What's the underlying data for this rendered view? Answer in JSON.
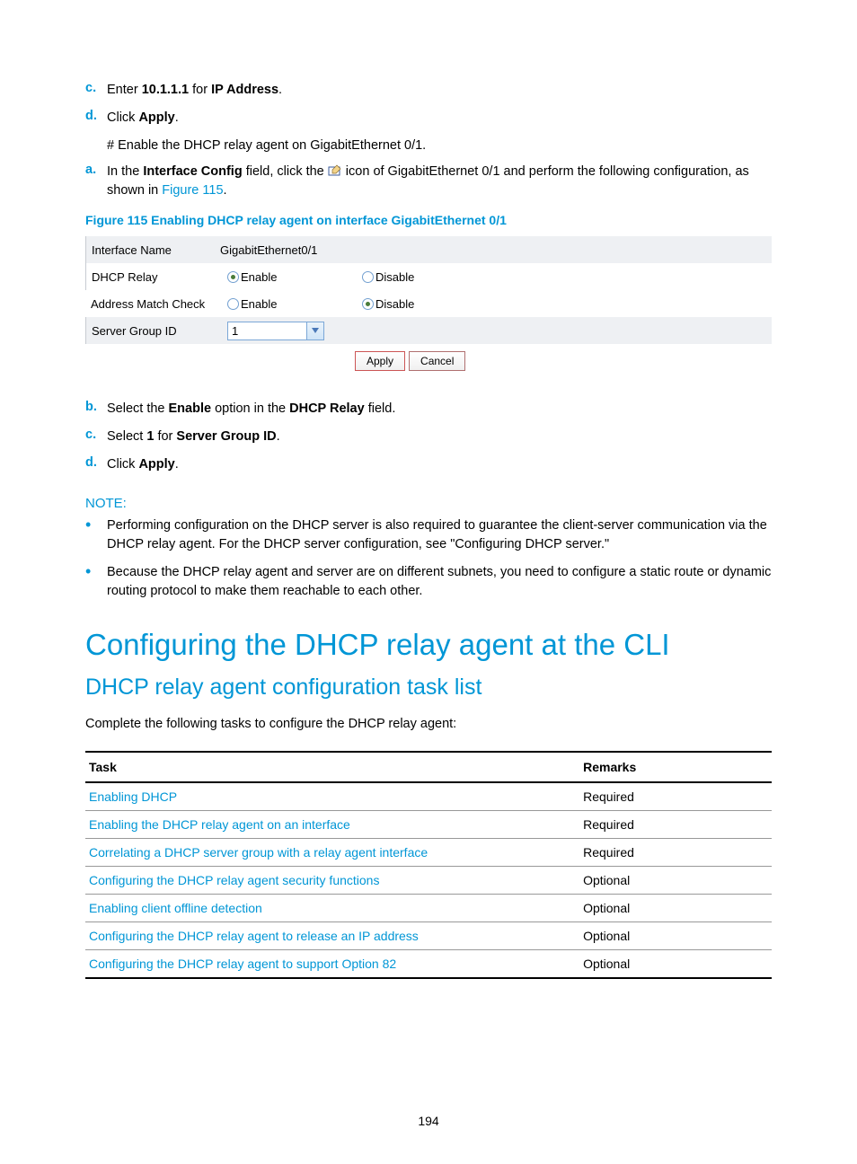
{
  "steps_top": [
    {
      "letter": "c.",
      "html": "Enter <b>10.1.1.1</b> for <b>IP Address</b>."
    },
    {
      "letter": "d.",
      "html": "Click <b>Apply</b>."
    }
  ],
  "hash_line": "# Enable the DHCP relay agent on GigabitEthernet 0/1.",
  "step_a_prefix": "In the ",
  "step_a_bold1": "Interface Config",
  "step_a_mid1": " field, click the ",
  "step_a_mid2": " icon of GigabitEthernet 0/1 and perform the following configuration, as shown in ",
  "step_a_link": "Figure 115",
  "step_a_end": ".",
  "figure_caption": "Figure 115 Enabling DHCP relay agent on interface GigabitEthernet 0/1",
  "fig": {
    "rows": {
      "r1_label": "Interface Name",
      "r1_val": "GigabitEthernet0/1",
      "r2_label": "DHCP Relay",
      "r2_optA": "Enable",
      "r2_optB": "Disable",
      "r3_label": "Address Match Check",
      "r3_optA": "Enable",
      "r3_optB": "Disable",
      "r4_label": "Server Group ID",
      "r4_val": "1"
    },
    "apply": "Apply",
    "cancel": "Cancel"
  },
  "steps_mid": [
    {
      "letter": "b.",
      "html": "Select the <b>Enable</b> option in the <b>DHCP Relay</b> field."
    },
    {
      "letter": "c.",
      "html": "Select <b>1</b> for <b>Server Group ID</b>."
    },
    {
      "letter": "d.",
      "html": "Click <b>Apply</b>."
    }
  ],
  "note_head": "NOTE:",
  "notes": [
    "Performing configuration on the DHCP server is also required to guarantee the client-server communication via the DHCP relay agent. For the DHCP server configuration, see \"Configuring DHCP server.\"",
    "Because the DHCP relay agent and server are on different subnets, you need to configure a static route or dynamic routing protocol to make them reachable to each other."
  ],
  "h1": "Configuring the DHCP relay agent at the CLI",
  "h2": "DHCP relay agent configuration task list",
  "intro": "Complete the following tasks to configure the DHCP relay agent:",
  "table": {
    "col1": "Task",
    "col2": "Remarks",
    "rows": [
      {
        "task": "Enabling DHCP",
        "rem": "Required"
      },
      {
        "task": "Enabling the DHCP relay agent on an interface",
        "rem": "Required"
      },
      {
        "task": "Correlating a DHCP server group with a relay agent interface",
        "rem": "Required"
      },
      {
        "task": "Configuring the DHCP relay agent security functions",
        "rem": "Optional"
      },
      {
        "task": "Enabling client offline detection",
        "rem": "Optional"
      },
      {
        "task": "Configuring the DHCP relay agent to release an IP address",
        "rem": "Optional"
      },
      {
        "task": "Configuring the DHCP relay agent to support Option 82",
        "rem": "Optional"
      }
    ]
  },
  "page_number": "194"
}
